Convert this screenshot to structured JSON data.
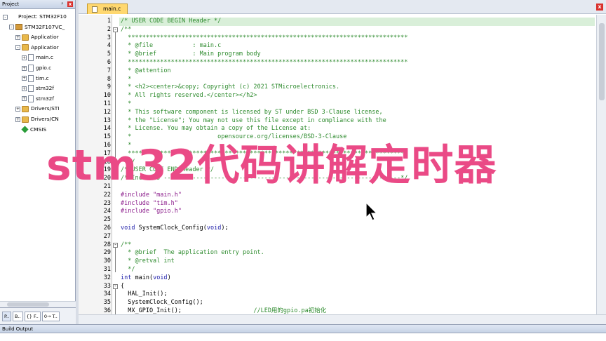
{
  "project_panel": {
    "title": "Project",
    "pin": "ᵖ",
    "close": "x",
    "tree": [
      {
        "label": "Project: STM32F10",
        "indent": 0,
        "expander": "-",
        "icon": "project"
      },
      {
        "label": "STM32F107VC_",
        "indent": 1,
        "expander": "-",
        "icon": "target"
      },
      {
        "label": "Applicatior",
        "indent": 2,
        "expander": "+",
        "icon": "folder"
      },
      {
        "label": "Applicatior",
        "indent": 2,
        "expander": "-",
        "icon": "folder"
      },
      {
        "label": "main.c",
        "indent": 3,
        "expander": "+",
        "icon": "file"
      },
      {
        "label": "gpio.c",
        "indent": 3,
        "expander": "+",
        "icon": "file"
      },
      {
        "label": "tim.c",
        "indent": 3,
        "expander": "+",
        "icon": "file"
      },
      {
        "label": "stm32f",
        "indent": 3,
        "expander": "+",
        "icon": "file"
      },
      {
        "label": "stm32f",
        "indent": 3,
        "expander": "+",
        "icon": "file"
      },
      {
        "label": "Drivers/STI",
        "indent": 2,
        "expander": "+",
        "icon": "folder"
      },
      {
        "label": "Drivers/CN",
        "indent": 2,
        "expander": "+",
        "icon": "folder"
      },
      {
        "label": "CMSIS",
        "indent": 2,
        "expander": "",
        "icon": "cmsis"
      }
    ],
    "tabs": [
      "P..",
      "B..",
      "{} F..",
      "0→ T.."
    ]
  },
  "editor": {
    "file_tab": "main.c",
    "close": "x",
    "lines": [
      {
        "n": "1",
        "parts": [
          {
            "t": "/* USER CODE BEGIN Header */",
            "c": "comment"
          }
        ]
      },
      {
        "n": "2",
        "fold": "-",
        "parts": [
          {
            "t": "/**",
            "c": "comment"
          }
        ]
      },
      {
        "n": "3",
        "parts": [
          {
            "t": "  ******************************************************************************",
            "c": "comment"
          }
        ]
      },
      {
        "n": "4",
        "parts": [
          {
            "t": "  * @file           : main.c",
            "c": "comment"
          }
        ]
      },
      {
        "n": "5",
        "parts": [
          {
            "t": "  * @brief          : Main program body",
            "c": "comment"
          }
        ]
      },
      {
        "n": "6",
        "parts": [
          {
            "t": "  ******************************************************************************",
            "c": "comment"
          }
        ]
      },
      {
        "n": "7",
        "parts": [
          {
            "t": "  * @attention",
            "c": "comment"
          }
        ]
      },
      {
        "n": "8",
        "parts": [
          {
            "t": "  *",
            "c": "comment"
          }
        ]
      },
      {
        "n": "9",
        "parts": [
          {
            "t": "  * <h2><center>&copy; Copyright (c) 2021 STMicroelectronics.",
            "c": "comment"
          }
        ]
      },
      {
        "n": "10",
        "parts": [
          {
            "t": "  * All rights reserved.</center></h2>",
            "c": "comment"
          }
        ]
      },
      {
        "n": "11",
        "parts": [
          {
            "t": "  *",
            "c": "comment"
          }
        ]
      },
      {
        "n": "12",
        "parts": [
          {
            "t": "  * This software component is licensed by ST under BSD 3-Clause license,",
            "c": "comment"
          }
        ]
      },
      {
        "n": "13",
        "parts": [
          {
            "t": "  * the \"License\"; You may not use this file except in compliance with the",
            "c": "comment"
          }
        ]
      },
      {
        "n": "14",
        "parts": [
          {
            "t": "  * License. You may obtain a copy of the License at:",
            "c": "comment"
          }
        ]
      },
      {
        "n": "15",
        "parts": [
          {
            "t": "  *                        opensource.org/licenses/BSD-3-Clause",
            "c": "comment"
          }
        ]
      },
      {
        "n": "16",
        "parts": [
          {
            "t": "  *",
            "c": "comment"
          }
        ]
      },
      {
        "n": "17",
        "parts": [
          {
            "t": "  ******************************************************************************",
            "c": "comment"
          }
        ]
      },
      {
        "n": "18",
        "parts": [
          {
            "t": "  */",
            "c": "comment"
          }
        ]
      },
      {
        "n": "19",
        "parts": [
          {
            "t": "/* USER CODE END Header */",
            "c": "comment"
          }
        ]
      },
      {
        "n": "20",
        "parts": [
          {
            "t": "/* Includes ------------------------------------------------------------------*/",
            "c": "comment"
          }
        ]
      },
      {
        "n": "21",
        "parts": [
          {
            "t": "",
            "c": "plain"
          }
        ]
      },
      {
        "n": "22",
        "parts": [
          {
            "t": "#include ",
            "c": "pp"
          },
          {
            "t": "\"main.h\"",
            "c": "str"
          }
        ]
      },
      {
        "n": "23",
        "parts": [
          {
            "t": "#include ",
            "c": "pp"
          },
          {
            "t": "\"tim.h\"",
            "c": "str"
          }
        ]
      },
      {
        "n": "24",
        "parts": [
          {
            "t": "#include ",
            "c": "pp"
          },
          {
            "t": "\"gpio.h\"",
            "c": "str"
          }
        ]
      },
      {
        "n": "25",
        "parts": [
          {
            "t": "",
            "c": "plain"
          }
        ]
      },
      {
        "n": "26",
        "parts": [
          {
            "t": "void",
            "c": "kw"
          },
          {
            "t": " SystemClock_Config(",
            "c": "plain"
          },
          {
            "t": "void",
            "c": "kw"
          },
          {
            "t": ");",
            "c": "plain"
          }
        ]
      },
      {
        "n": "27",
        "parts": [
          {
            "t": "",
            "c": "plain"
          }
        ]
      },
      {
        "n": "28",
        "fold": "-",
        "parts": [
          {
            "t": "/**",
            "c": "comment"
          }
        ]
      },
      {
        "n": "29",
        "parts": [
          {
            "t": "  * @brief  The application entry point.",
            "c": "comment"
          }
        ]
      },
      {
        "n": "30",
        "parts": [
          {
            "t": "  * @retval int",
            "c": "comment"
          }
        ]
      },
      {
        "n": "31",
        "parts": [
          {
            "t": "  */",
            "c": "comment"
          }
        ]
      },
      {
        "n": "32",
        "parts": [
          {
            "t": "int",
            "c": "kw"
          },
          {
            "t": " main(",
            "c": "plain"
          },
          {
            "t": "void",
            "c": "kw"
          },
          {
            "t": ")",
            "c": "plain"
          }
        ]
      },
      {
        "n": "33",
        "fold": "-",
        "parts": [
          {
            "t": "{",
            "c": "plain"
          }
        ]
      },
      {
        "n": "34",
        "parts": [
          {
            "t": "  HAL_Init();",
            "c": "plain"
          }
        ]
      },
      {
        "n": "35",
        "parts": [
          {
            "t": "  SystemClock_Config();",
            "c": "plain"
          }
        ]
      },
      {
        "n": "36",
        "parts": [
          {
            "t": "  MX_GPIO_Init();",
            "c": "plain"
          },
          {
            "t": "                    //LED用的gpio.pa初始化",
            "c": "comment"
          }
        ]
      }
    ]
  },
  "build_output": {
    "title": "Build Output"
  },
  "overlay": {
    "title": "stm32代码讲解定时器"
  },
  "colors": {
    "overlay": "#ea4a86",
    "comment": "#2e8b2e",
    "keyword": "#1a1aa8",
    "preprocessor": "#8a1a8a"
  }
}
